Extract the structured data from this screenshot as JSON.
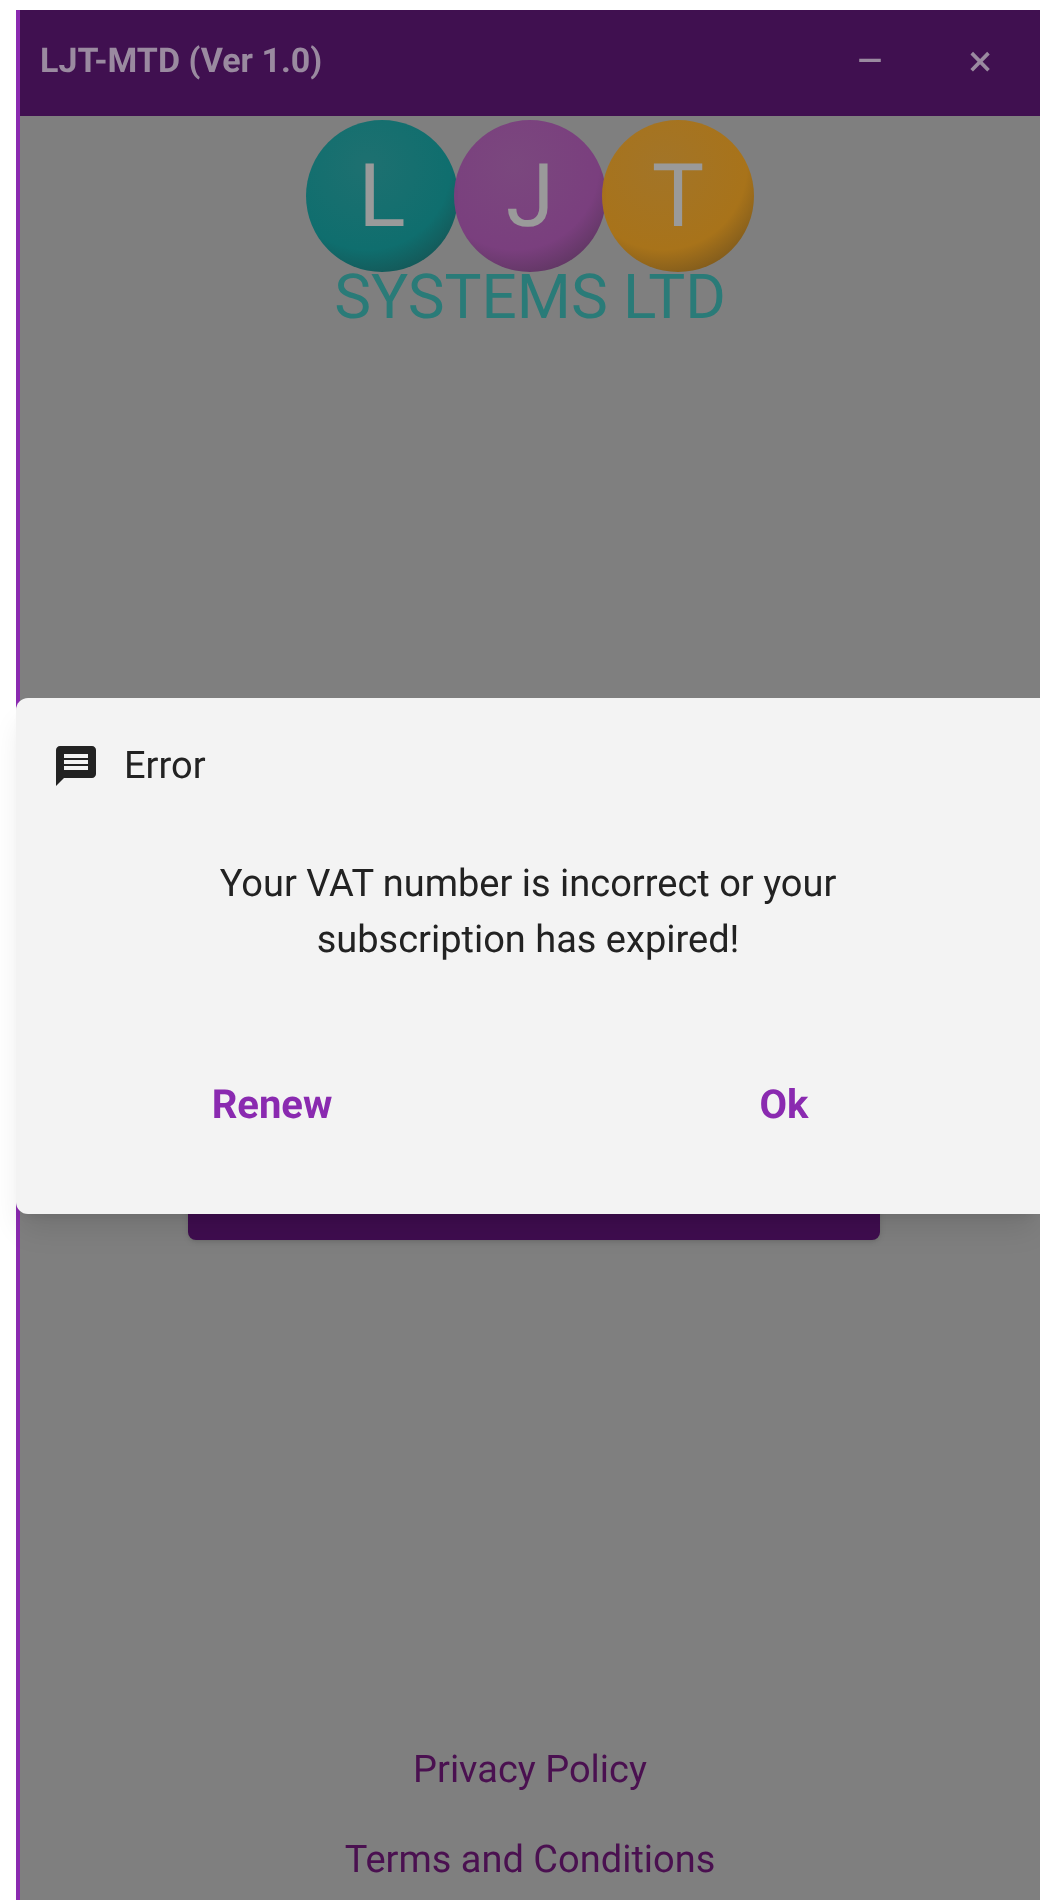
{
  "window": {
    "title": "LJT-MTD (Ver 1.0)",
    "controls": [
      "–",
      "×"
    ]
  },
  "logo": {
    "letters": [
      {
        "char": "L",
        "color": "#0f6e6e"
      },
      {
        "char": "J",
        "color": "#7a3f7e"
      },
      {
        "char": "T",
        "color": "#a8731a"
      }
    ],
    "name": "SYSTEMS LTD"
  },
  "dialog": {
    "title": "Error",
    "message": "Your VAT number is incorrect or your subscription has expired!",
    "buttons": [
      "Renew",
      "Ok"
    ]
  },
  "footer_links": [
    "Privacy Policy",
    "Terms and Conditions"
  ]
}
